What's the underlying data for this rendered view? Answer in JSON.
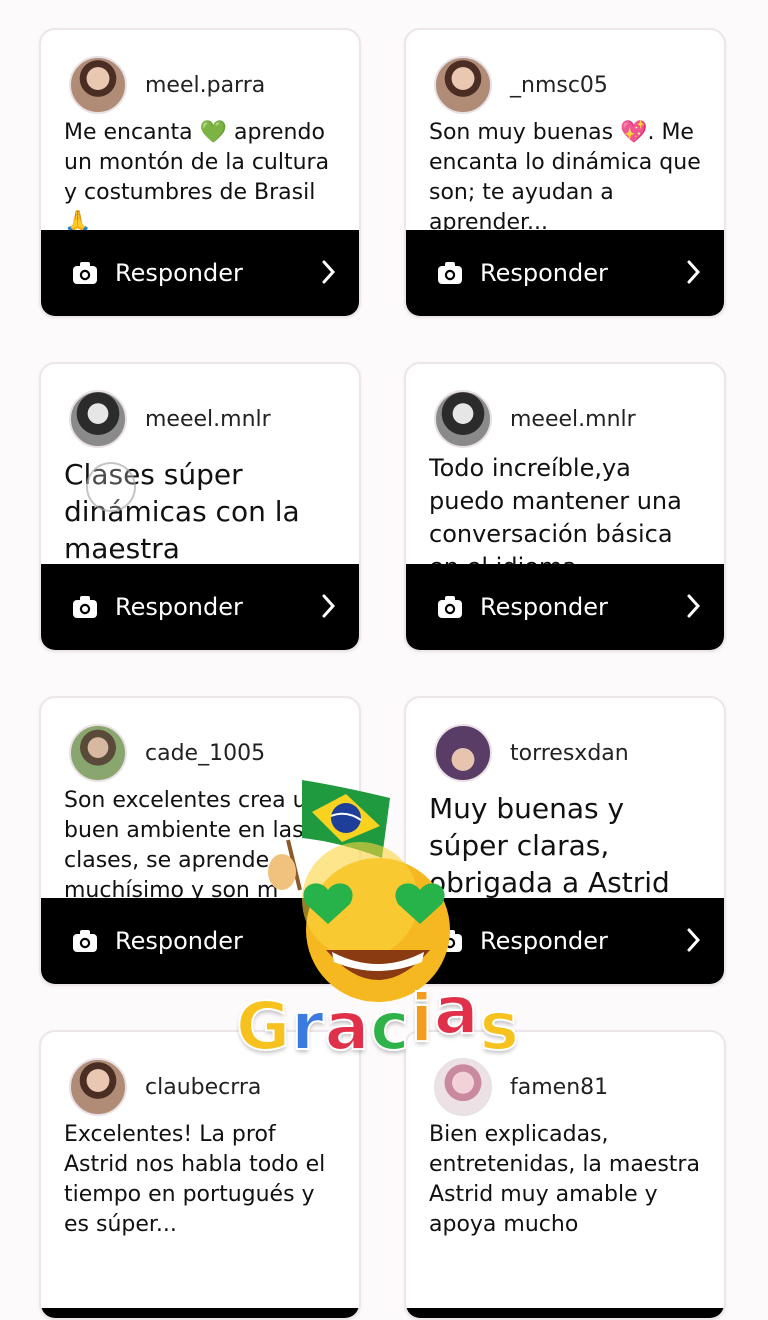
{
  "reply_label": "Responder",
  "cards": [
    {
      "username": "meel.parra",
      "comment": "Me encanta 💚 aprendo un montón de la cultura y costumbres de Brasil 🙏",
      "avatar": "avatar-photo"
    },
    {
      "username": "_nmsc05",
      "comment": "Son muy buenas 💖. Me encanta lo dinámica que son; te ayudan a aprender...",
      "avatar": "avatar-photo"
    },
    {
      "username": "meeel.mnlr",
      "comment": "Clases súper dinámicas con la maestra",
      "avatar": "avatar-photo-bw"
    },
    {
      "username": "meeel.mnlr",
      "comment": "Todo increíble,ya puedo mantener una conversación básica en el idioma",
      "avatar": "avatar-photo-bw"
    },
    {
      "username": "cade_1005",
      "comment": "Son excelentes crea un buen ambiente en las clases, se aprende muchísimo y son m",
      "avatar": "avatar-photo"
    },
    {
      "username": "torresxdan",
      "comment": "Muy buenas y súper claras, obrigada a Astrid",
      "avatar": "avatar-photo"
    },
    {
      "username": "claubecrra",
      "comment": "Excelentes! La prof Astrid nos habla todo el tiempo en portugués y es súper...",
      "avatar": "avatar-photo"
    },
    {
      "username": "famen81",
      "comment": "Bien explicadas, entretenidas, la maestra Astrid muy amable y apoya mucho",
      "avatar": "avatar-photo"
    }
  ],
  "sticker_text": [
    "G",
    "r",
    "a",
    "c",
    "i",
    "a",
    "s"
  ],
  "colors": {
    "reply_bar": "#000000",
    "card_border": "#ece6ea",
    "gracias": [
      "#f7c21e",
      "#3b7be0",
      "#e0304a",
      "#2fb24a",
      "#f39c1e",
      "#e0304a",
      "#f7c21e"
    ]
  }
}
